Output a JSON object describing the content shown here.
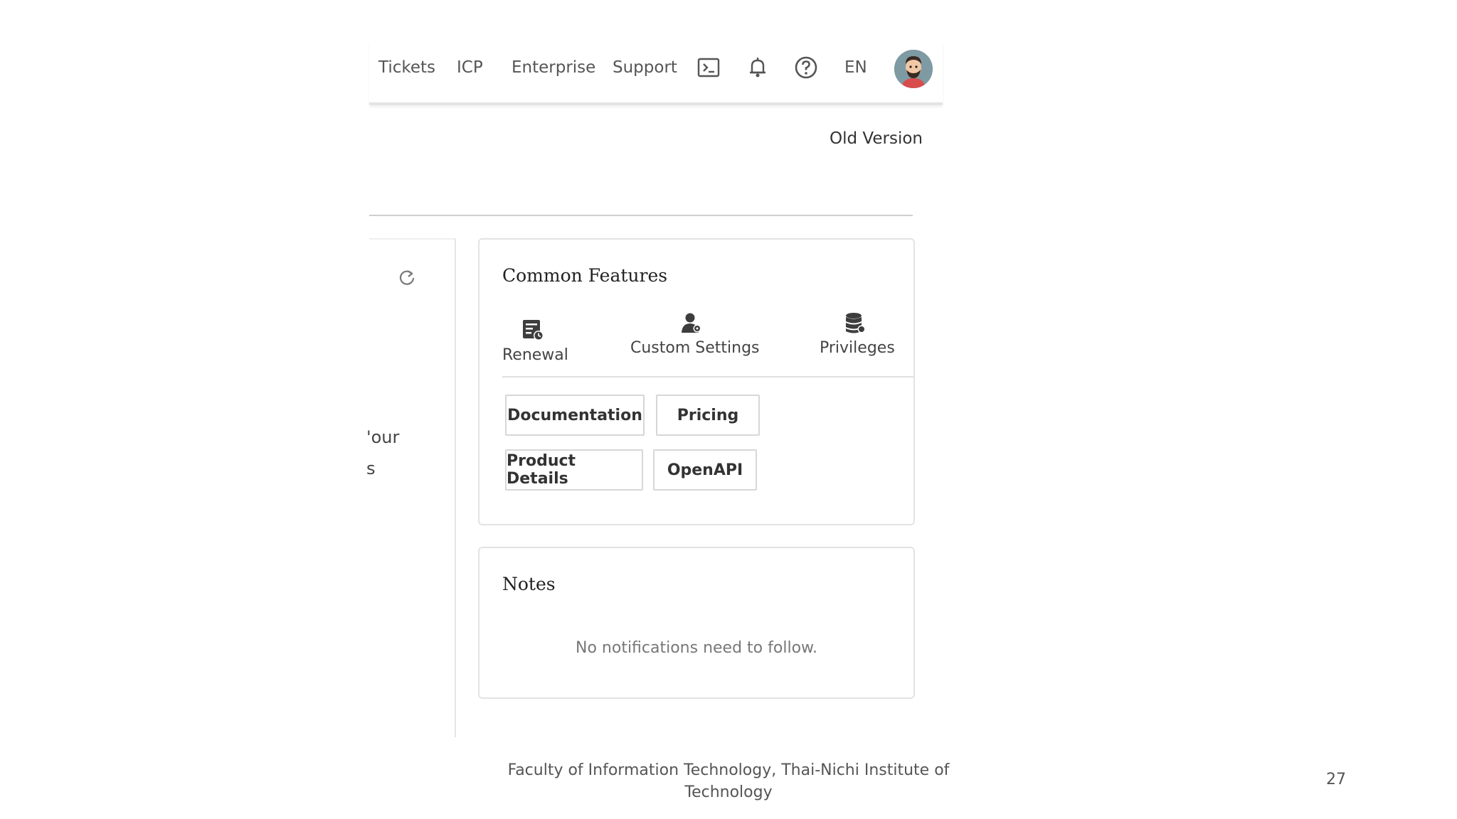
{
  "header": {
    "nav": [
      "Tickets",
      "ICP",
      "Enterprise",
      "Support"
    ],
    "language": "EN",
    "icons": [
      "terminal-icon",
      "bell-icon",
      "help-icon"
    ],
    "avatar": "user-avatar"
  },
  "old_version_link": "Old Version",
  "left_panel": {
    "refresh_icon": "refresh-icon",
    "text_line_1": "'our",
    "text_line_2": "s"
  },
  "common_features": {
    "title": "Common Features",
    "items": [
      {
        "label": "Renewal",
        "icon": "renewal-icon"
      },
      {
        "label": "Custom Settings",
        "icon": "user-settings-icon"
      },
      {
        "label": "Privileges",
        "icon": "database-icon"
      }
    ],
    "links": [
      "Documentation",
      "Pricing",
      "Product Details",
      "OpenAPI"
    ]
  },
  "notes": {
    "title": "Notes",
    "empty_message": "No notifications need to follow."
  },
  "slide": {
    "footer": "Faculty of Information Technology, Thai-Nichi Institute of Technology",
    "page_number": "27"
  },
  "colors": {
    "border": "#e3e3e3",
    "text": "#333333",
    "muted": "#777777"
  }
}
